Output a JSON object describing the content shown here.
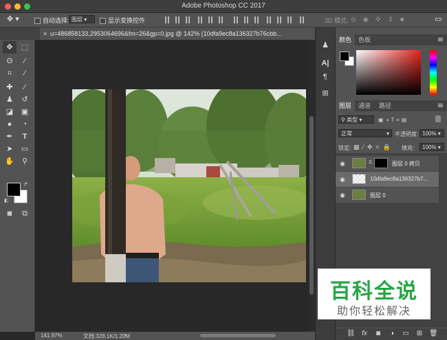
{
  "window": {
    "title": "Adobe Photoshop CC 2017",
    "traffic_lights": [
      "#fc5c57",
      "#fdbc2e",
      "#34c84a"
    ]
  },
  "options_bar": {
    "auto_select_label": "自动选择:",
    "auto_select_value": "图层",
    "show_transform_label": "显示变换控件",
    "mode_3d_label": "3D 模式:"
  },
  "document_tab": {
    "close_glyph": "×",
    "title": "u=486858133,2953064696&fm=26&gp=0.jpg @ 142% (10dfa9ec8a136327b76cbb..."
  },
  "status_bar": {
    "zoom": "141.97%",
    "doc_size": "文档:328.1K/1.20M"
  },
  "color_panel": {
    "tabs": [
      "颜色",
      "色板"
    ],
    "foreground": "#000000",
    "background": "#ffffff"
  },
  "layers_panel": {
    "tabs": [
      "图层",
      "通道",
      "路径"
    ],
    "filter_label": "类型",
    "blend_mode": "正常",
    "opacity_label": "不透明度:",
    "opacity_value": "100%",
    "lock_label": "锁定:",
    "fill_label": "填充:",
    "fill_value": "100%",
    "layers": [
      {
        "name": "图层 0 拷贝",
        "visible": true,
        "selected": false
      },
      {
        "name": "10dfa9ec8a136327b7...",
        "visible": true,
        "selected": true
      },
      {
        "name": "图层 0",
        "visible": true,
        "selected": false
      }
    ]
  },
  "watermark": {
    "title": "百科全说",
    "subtitle": "助你轻松解决",
    "color": "#25a644"
  },
  "icons": [
    "move-icon",
    "marquee-icon",
    "lasso-icon",
    "magic-wand-icon",
    "crop-icon",
    "eyedropper-icon",
    "healing-brush-icon",
    "brush-icon",
    "clone-stamp-icon",
    "history-brush-icon",
    "eraser-icon",
    "gradient-icon",
    "blur-icon",
    "dodge-icon",
    "pen-icon",
    "type-icon",
    "path-select-icon",
    "rectangle-icon",
    "hand-icon",
    "zoom-icon"
  ]
}
